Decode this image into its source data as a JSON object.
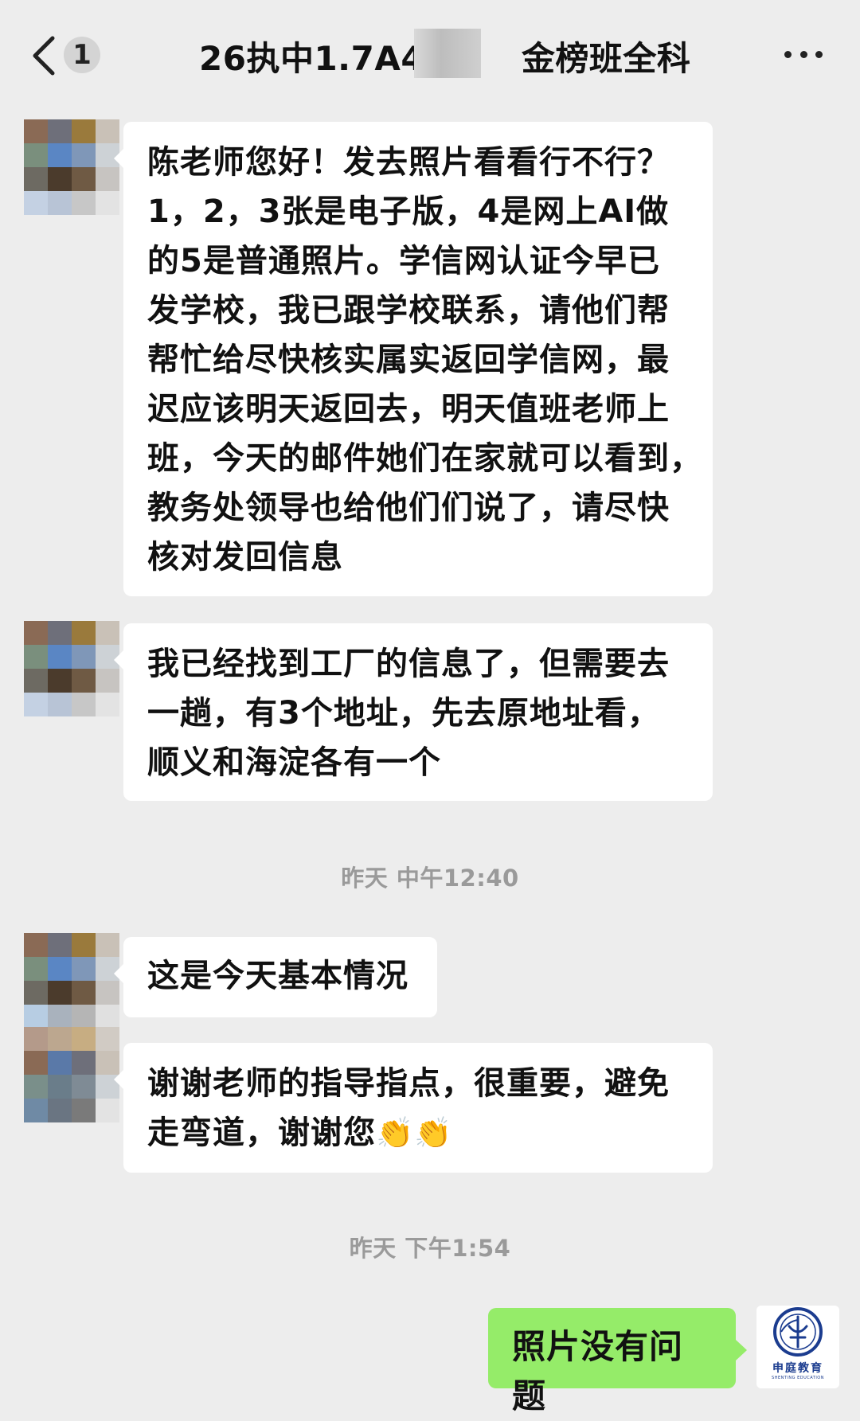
{
  "header": {
    "unread_count": "1",
    "title": "26执中1.7A49",
    "title_suffix": "金榜班全科"
  },
  "messages": [
    {
      "side": "left",
      "text": "陈老师您好！发去照片看看行不行？1，2，3张是电子版，4是网上AI做的5是普通照片。学信网认证今早已发学校，我已跟学校联系，请他们帮帮忙给尽快核实属实返回学信网，最迟应该明天返回去，明天值班老师上班，今天的邮件她们在家就可以看到，教务处领导也给他们们说了，请尽快核对发回信息"
    },
    {
      "side": "left",
      "text": "我已经找到工厂的信息了，但需要去一趟，有3个地址，先去原地址看，顺义和海淀各有一个"
    },
    {
      "side": "left",
      "text": "这是今天基本情况"
    },
    {
      "side": "left",
      "text": "谢谢老师的指导指点，很重要，避免走弯道，谢谢您"
    },
    {
      "side": "right",
      "text": "照片没有问题"
    }
  ],
  "message_lines": {
    "m1": [
      "陈老师您好！发去照片看看行不行？",
      "1，2，3张是电子版，4是网上AI做",
      "的5是普通照片。学信网认证今早已",
      "发学校，我已跟学校联系，请他们帮",
      "帮忙给尽快核实属实返回学信网，最",
      "迟应该明天返回去，明天值班老师上",
      "班，今天的邮件她们在家就可以看到，",
      "教务处领导也给他们们说了，请尽快",
      "核对发回信息"
    ],
    "m2": [
      "我已经找到工厂的信息了，但需要去",
      "一趟，有3个地址，先去原地址看，",
      "顺义和海淀各有一个"
    ],
    "m4": [
      "谢谢老师的指导指点，很重要，避免",
      "走弯道，谢谢您"
    ]
  },
  "emoji": {
    "clap": "👏👏",
    "icon_name": "clapping-hands-icon"
  },
  "timestamps": {
    "t1": "昨天 中午12:40",
    "t2": "昨天 下午1:54"
  },
  "self_avatar": {
    "title": "申庭教育",
    "subtitle": "SHENTING EDUCATION",
    "color": "#1b3c8f"
  },
  "colors": {
    "background": "#ededed",
    "incoming_bubble": "#ffffff",
    "outgoing_bubble": "#95ec69",
    "timestamp_text": "#9a9a9a"
  }
}
